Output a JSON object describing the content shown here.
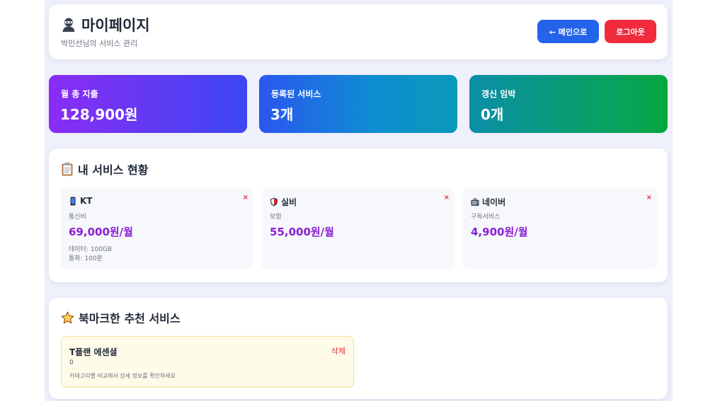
{
  "header": {
    "title": "마이페이지",
    "subtitle": "박민선님의 서비스 관리",
    "main_button": "← 메인으로",
    "logout_button": "로그아웃",
    "avatar_icon": "user-ninja-icon"
  },
  "stats": [
    {
      "label": "월 총 지출",
      "value": "128,900원"
    },
    {
      "label": "등록된 서비스",
      "value": "3개"
    },
    {
      "label": "갱신 임박",
      "value": "0개"
    }
  ],
  "services_section": {
    "title": "내 서비스 현황",
    "icon": "clipboard-icon",
    "delete_label": "×",
    "items": [
      {
        "name": "KT",
        "icon": "mobile-phone-icon",
        "category": "통신비",
        "price": "69,000원/월",
        "details": [
          "데이터: 100GB",
          "통화: 100분"
        ]
      },
      {
        "name": "실비",
        "icon": "shield-icon",
        "category": "보험",
        "price": "55,000원/월",
        "details": []
      },
      {
        "name": "네이버",
        "icon": "tv-icon",
        "category": "구독서비스",
        "price": "4,900원/월",
        "details": []
      }
    ]
  },
  "bookmarks_section": {
    "title": "북마크한 추천 서비스",
    "icon": "star-icon",
    "items": [
      {
        "name": "T플랜 에센셜",
        "value": "0",
        "note": "카테고리별 비교에서 상세 정보를 확인하세요",
        "delete_label": "삭제"
      }
    ]
  },
  "colors": {
    "primary": "#2563eb",
    "danger": "#ef2b3c",
    "price": "#8a1fd6"
  }
}
